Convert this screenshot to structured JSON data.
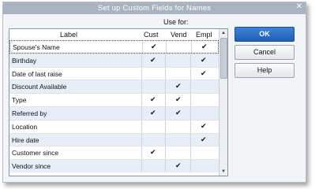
{
  "window": {
    "title": "Set up Custom Fields for Names",
    "close_glyph": "✕"
  },
  "use_for_label": "Use for:",
  "columns": {
    "label": "Label",
    "cust": "Cust",
    "vend": "Vend",
    "empl": "Empl"
  },
  "check_glyph": "✔",
  "rows": [
    {
      "label": "Spouse's Name",
      "cust": "✔",
      "vend": "",
      "empl": "✔"
    },
    {
      "label": "Birthday",
      "cust": "✔",
      "vend": "",
      "empl": "✔"
    },
    {
      "label": "Date of last raise",
      "cust": "",
      "vend": "",
      "empl": "✔"
    },
    {
      "label": "Discount Available",
      "cust": "",
      "vend": "✔",
      "empl": ""
    },
    {
      "label": "Type",
      "cust": "✔",
      "vend": "✔",
      "empl": ""
    },
    {
      "label": "Referred by",
      "cust": "✔",
      "vend": "✔",
      "empl": ""
    },
    {
      "label": "Location",
      "cust": "",
      "vend": "",
      "empl": "✔"
    },
    {
      "label": "Hire date",
      "cust": "",
      "vend": "",
      "empl": "✔"
    },
    {
      "label": "Customer since",
      "cust": "✔",
      "vend": "",
      "empl": ""
    },
    {
      "label": "Vendor since",
      "cust": "",
      "vend": "✔",
      "empl": ""
    }
  ],
  "buttons": {
    "ok": "OK",
    "cancel": "Cancel",
    "help": "Help"
  },
  "colors": {
    "titlebar": "#a9b3c2",
    "ok_button": "#2a6cc6",
    "alt_row": "#e7eef8"
  }
}
